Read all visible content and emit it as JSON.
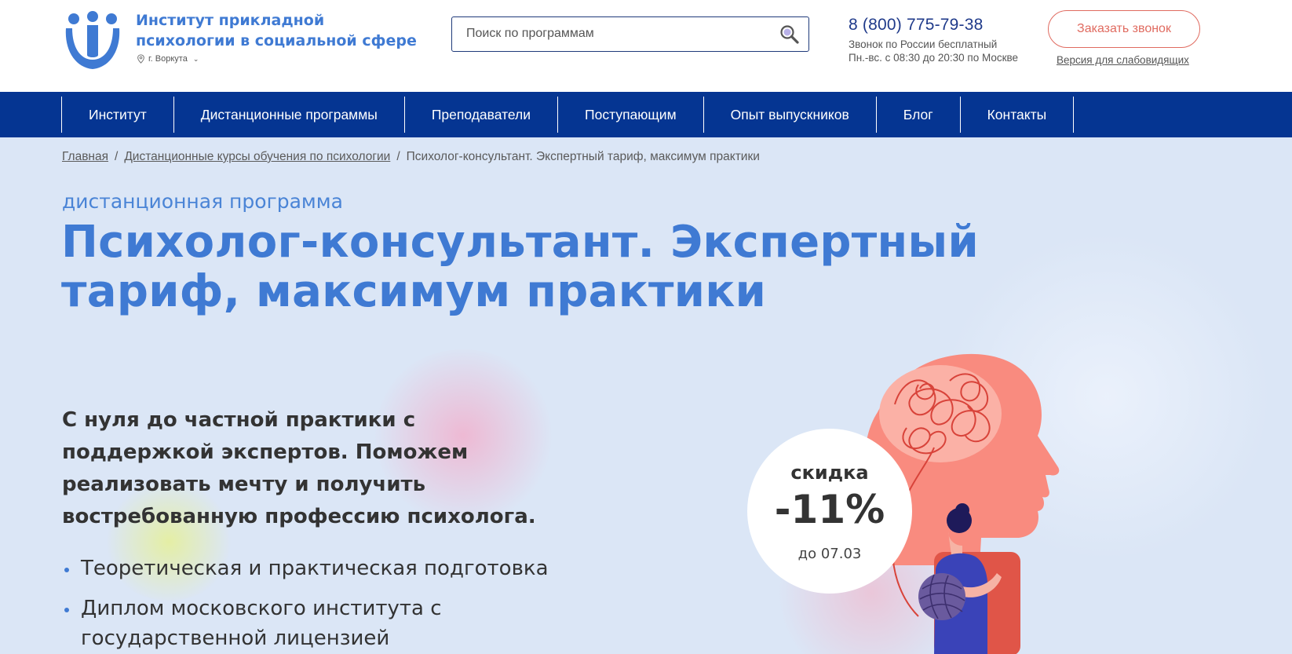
{
  "brand": {
    "title": "Институт прикладной психологии в социальной сфере",
    "city": "г. Воркута"
  },
  "search": {
    "placeholder": "Поиск по программам"
  },
  "contact": {
    "phone": "8 (800) 775-79-38",
    "note_line1": "Звонок по России бесплатный",
    "note_line2": "Пн.-вс. с 08:30 до 20:30 по Москве"
  },
  "header_actions": {
    "callback_label": "Заказать звонок",
    "accessible_label": "Версия для слабовидящих"
  },
  "nav": {
    "items": [
      {
        "label": "Институт"
      },
      {
        "label": "Дистанционные программы"
      },
      {
        "label": "Преподаватели"
      },
      {
        "label": "Поступающим"
      },
      {
        "label": "Опыт выпускников"
      },
      {
        "label": "Блог"
      },
      {
        "label": "Контакты"
      }
    ]
  },
  "breadcrumb": {
    "home": "Главная",
    "section": "Дистанционные курсы обучения по психологии",
    "current": "Психолог-консультант. Экспертный тариф, максимум практики"
  },
  "hero": {
    "eyebrow": "дистанционная программа",
    "title": "Психолог-консультант. Экспертный тариф, максимум практики",
    "lead": "С нуля до частной практики с поддержкой экспертов. Поможем реализовать мечту и получить востребованную профессию психолога.",
    "features": [
      "Теоретическая и практическая подготовка",
      "Диплом московского института с государственной лицензией"
    ]
  },
  "discount": {
    "label": "скидка",
    "value": "-11%",
    "until": "до 07.03"
  },
  "colors": {
    "brand_blue": "#3f7ad3",
    "nav_blue": "#053592",
    "accent_red": "#e06b60",
    "hero_bg": "#dbe6f6"
  }
}
